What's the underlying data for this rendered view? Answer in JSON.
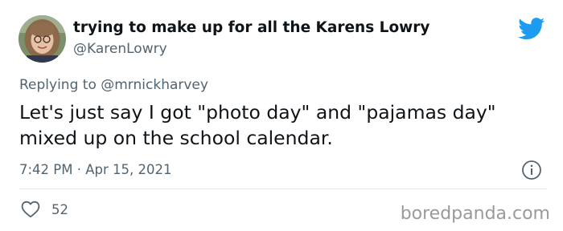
{
  "tweet": {
    "display_name": "trying to make up for all the Karens Lowry",
    "handle": "@KarenLowry",
    "replying_prefix": "Replying to",
    "replying_to": "@mrnickharvey",
    "text": "Let's just say I got \"photo day\" and \"pajamas day\" mixed up on the school calendar.",
    "timestamp": "7:42 PM · Apr 15, 2021",
    "like_count": "52"
  },
  "icons": {
    "logo": "twitter-bird-icon",
    "info": "info-icon",
    "like": "heart-icon"
  },
  "colors": {
    "twitter_blue": "#1d9bf0",
    "secondary_text": "#536471",
    "primary_text": "#0f1419",
    "divider": "#e1e8ed"
  },
  "watermark": "boredpanda.com"
}
